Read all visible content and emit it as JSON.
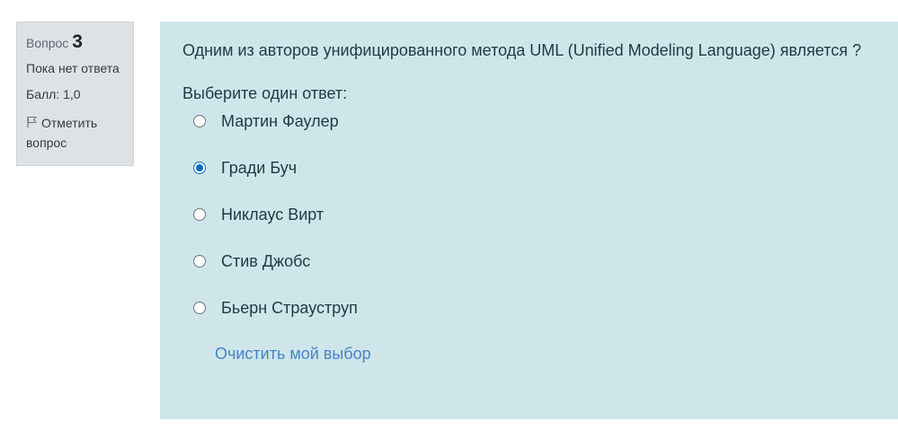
{
  "info": {
    "question_label": "Вопрос",
    "question_number": "3",
    "state": "Пока нет ответа",
    "grade": "Балл: 1,0",
    "flag_label": "Отметить вопрос",
    "flag_icon": "flag-icon"
  },
  "question": {
    "text": "Одним из авторов унифицированного метода UML (Unified Modeling Language) является ?",
    "prompt": "Выберите один ответ:",
    "answers": [
      {
        "label": "Мартин Фаулер",
        "selected": false
      },
      {
        "label": "Гради Буч",
        "selected": true
      },
      {
        "label": "Никлаус Вирт",
        "selected": false
      },
      {
        "label": "Стив Джобс",
        "selected": false
      },
      {
        "label": "Бьерн Страуструп",
        "selected": false
      }
    ],
    "clear_label": "Очистить мой выбор"
  },
  "colors": {
    "info_background": "#dee2e6",
    "content_background": "#cee6ea",
    "radio_selected": "#0f6cbf",
    "link": "#4a82c3"
  }
}
